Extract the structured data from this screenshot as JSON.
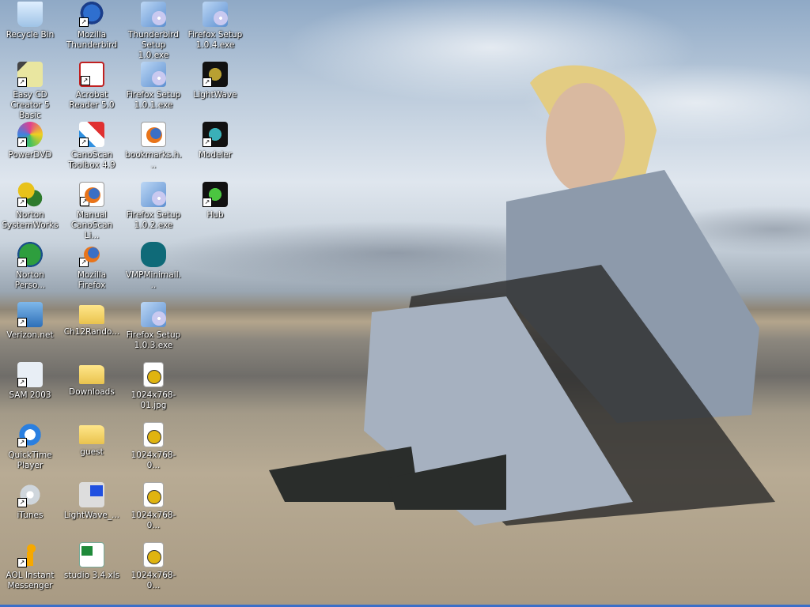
{
  "desktop": {
    "columns": [
      [
        {
          "label": "Recycle Bin",
          "icon": "recycle",
          "shortcut": false
        },
        {
          "label": "Easy CD Creator 5 Basic",
          "icon": "easycd",
          "shortcut": true
        },
        {
          "label": "PowerDVD",
          "icon": "powerdvd",
          "shortcut": true
        },
        {
          "label": "Norton SystemWorks",
          "icon": "norton-sw",
          "shortcut": true
        },
        {
          "label": "Norton Perso...",
          "icon": "norton-ps",
          "shortcut": true
        },
        {
          "label": "Verizon.net",
          "icon": "network",
          "shortcut": true
        },
        {
          "label": "SAM 2003",
          "icon": "sam",
          "shortcut": true
        },
        {
          "label": "QuickTime Player",
          "icon": "quicktime",
          "shortcut": true
        },
        {
          "label": "iTunes",
          "icon": "itunes",
          "shortcut": true
        },
        {
          "label": "AOL Instant Messenger",
          "icon": "aim",
          "shortcut": true
        }
      ],
      [
        {
          "label": "Mozilla Thunderbird",
          "icon": "thunderbird",
          "shortcut": true
        },
        {
          "label": "Acrobat Reader 5.0",
          "icon": "acrobat",
          "shortcut": true
        },
        {
          "label": "CanoScan Toolbox 4.9",
          "icon": "canoscan",
          "shortcut": true
        },
        {
          "label": "Manual CanoScan Li...",
          "icon": "firefox-doc",
          "shortcut": true
        },
        {
          "label": "Mozilla Firefox",
          "icon": "firefox",
          "shortcut": true
        },
        {
          "label": "Ch12Rando...",
          "icon": "folder",
          "shortcut": false
        },
        {
          "label": "Downloads",
          "icon": "folder",
          "shortcut": false
        },
        {
          "label": "guest",
          "icon": "folder",
          "shortcut": false
        },
        {
          "label": "LightWave_...",
          "icon": "lightwave-installer",
          "shortcut": false
        },
        {
          "label": "studio 3.4.xls",
          "icon": "excel",
          "shortcut": false
        }
      ],
      [
        {
          "label": "Thunderbird Setup 1.0.exe",
          "icon": "installer",
          "shortcut": false
        },
        {
          "label": "Firefox Setup 1.0.1.exe",
          "icon": "installer",
          "shortcut": false
        },
        {
          "label": "bookmarks.h...",
          "icon": "firefox-doc",
          "shortcut": false
        },
        {
          "label": "Firefox Setup 1.0.2.exe",
          "icon": "installer",
          "shortcut": false
        },
        {
          "label": "VMPMinimalI...",
          "icon": "vmp",
          "shortcut": false
        },
        {
          "label": "Firefox Setup 1.0.3.exe",
          "icon": "installer",
          "shortcut": false
        },
        {
          "label": "1024x768-01.jpg",
          "icon": "jpg",
          "shortcut": false
        },
        {
          "label": "1024x768-0...",
          "icon": "jpg",
          "shortcut": false
        },
        {
          "label": "1024x768-0...",
          "icon": "jpg",
          "shortcut": false
        },
        {
          "label": "1024x768-0...",
          "icon": "jpg",
          "shortcut": false
        }
      ],
      [
        {
          "label": "Firefox Setup 1.0.4.exe",
          "icon": "installer",
          "shortcut": false
        },
        {
          "label": "LightWave",
          "icon": "lightwave",
          "shortcut": true
        },
        {
          "label": "Modeler",
          "icon": "modeler",
          "shortcut": true
        },
        {
          "label": "Hub",
          "icon": "hub",
          "shortcut": true
        }
      ]
    ]
  }
}
